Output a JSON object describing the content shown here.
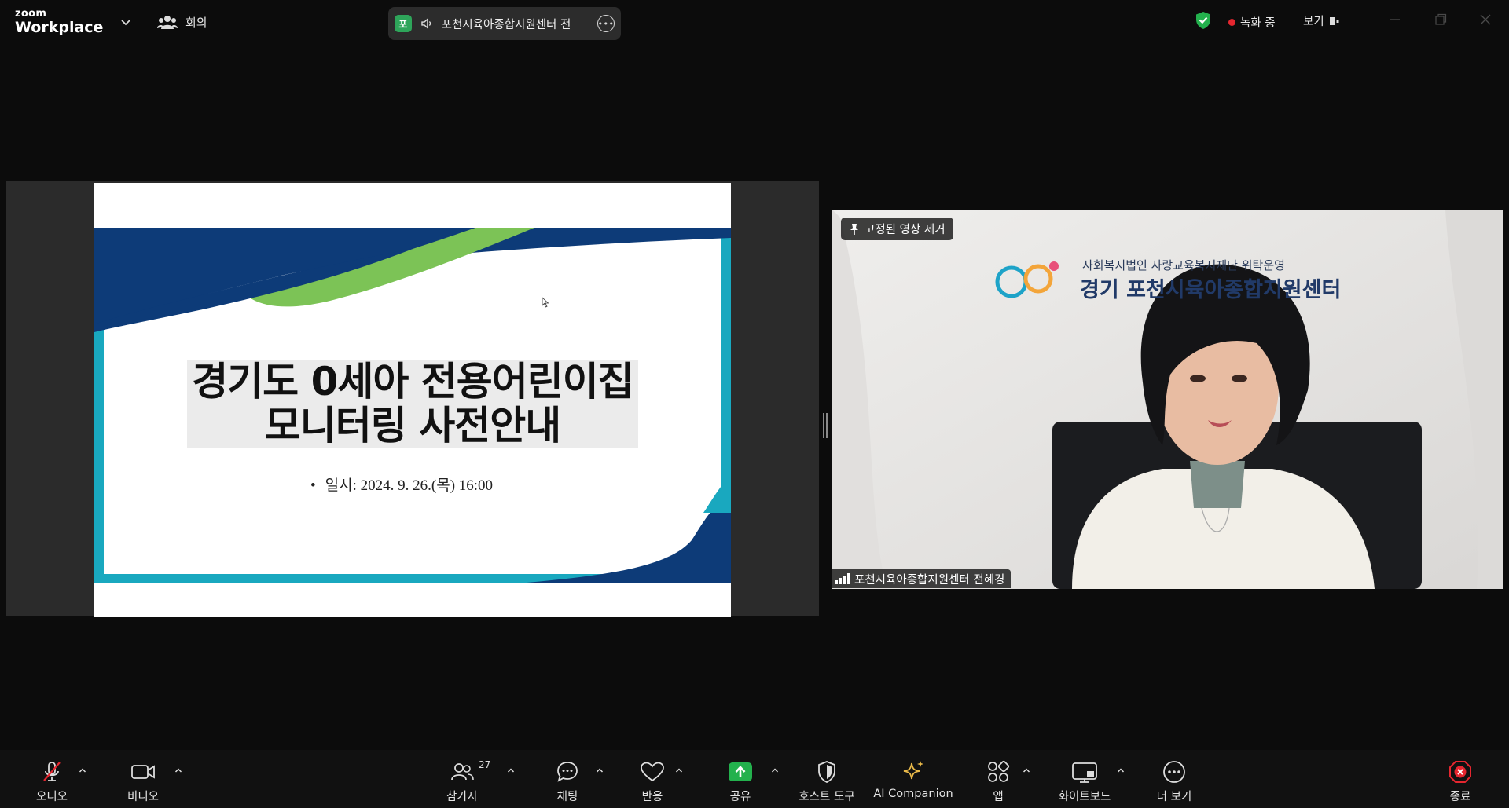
{
  "app": {
    "brand_top": "zoom",
    "brand_bottom": "Workplace"
  },
  "meeting_tab": {
    "label": "회의"
  },
  "active_speaker": {
    "avatar_initial": "포",
    "name": "포천시육아종합지원센터 전"
  },
  "status": {
    "recording_label": "녹화 중",
    "view_label": "보기"
  },
  "slide": {
    "title_line1": "경기도 0세아 전용어린이집",
    "title_line2": "모니터링 사전안내",
    "bullet": "•",
    "date_line": "일시: 2024. 9. 26.(목) 16:00"
  },
  "video": {
    "pin_label": "고정된 영상 제거",
    "participant_name": "포천시육아종합지원센터 전혜경",
    "banner_line1": "사회복지법인 사랑교육복지재단 위탁운영",
    "banner_line2": "경기 포천시육아종합지원센터"
  },
  "toolbar": {
    "audio": "오디오",
    "video": "비디오",
    "participants": "참가자",
    "participants_count": "27",
    "chat": "채팅",
    "reactions": "반응",
    "share": "공유",
    "host_tools": "호스트 도구",
    "ai_companion": "AI Companion",
    "apps": "앱",
    "whiteboard": "화이트보드",
    "more": "더 보기",
    "end": "종료"
  },
  "colors": {
    "share_green": "#23b14d",
    "end_red": "#e5262f",
    "ai_gold": "#e9b949",
    "slide_navy": "#0d3b78",
    "slide_teal": "#19a8bf",
    "slide_green": "#7cc356"
  }
}
